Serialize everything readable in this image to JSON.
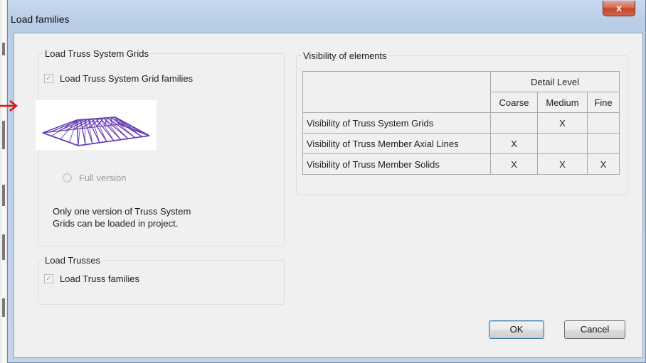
{
  "window": {
    "title": "Load families",
    "close_label": "x"
  },
  "truss_grids_group": {
    "legend": "Load Truss System Grids",
    "checkbox_label": "Load Truss System Grid families",
    "checked": true,
    "radio_label": "Full version",
    "note_line1": "Only one version of Truss System",
    "note_line2": "Grids can be loaded in project."
  },
  "trusses_group": {
    "legend": "Load Trusses",
    "checkbox_label": "Load Truss families",
    "checked": true
  },
  "visibility_group": {
    "legend": "Visibility of elements",
    "detail_level_header": "Detail Level",
    "columns": [
      "Coarse",
      "Medium",
      "Fine"
    ],
    "rows": [
      {
        "label": "Visibility of Truss System Grids",
        "cells": [
          "",
          "X",
          ""
        ]
      },
      {
        "label": "Visibility of Truss Member Axial Lines",
        "cells": [
          "X",
          "",
          ""
        ]
      },
      {
        "label": "Visibility of Truss Member Solids",
        "cells": [
          "X",
          "X",
          "X"
        ]
      }
    ]
  },
  "buttons": {
    "ok": "OK",
    "cancel": "Cancel"
  },
  "colors": {
    "arrow": "#e0140c",
    "roof_preview": "#6a3fb2"
  }
}
